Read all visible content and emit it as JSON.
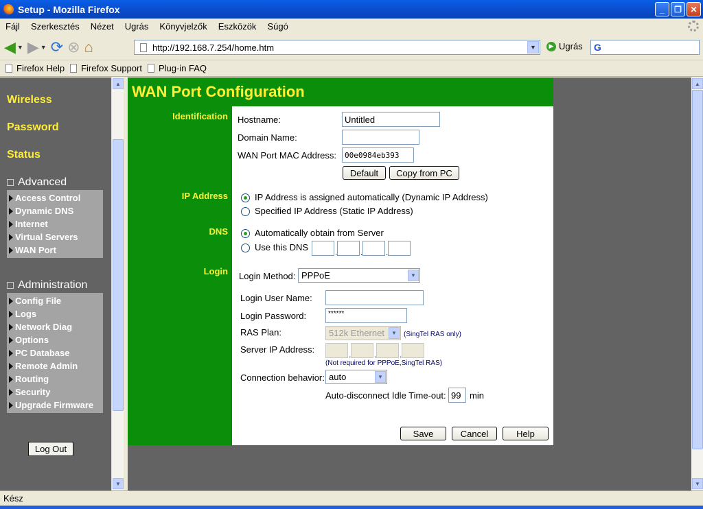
{
  "window": {
    "title": "Setup - Mozilla Firefox"
  },
  "menu": [
    "Fájl",
    "Szerkesztés",
    "Nézet",
    "Ugrás",
    "Könyvjelzők",
    "Eszközök",
    "Súgó"
  ],
  "toolbar": {
    "url": "http://192.168.7.254/home.htm",
    "go_label": "Ugrás"
  },
  "bookmarks": [
    "Firefox Help",
    "Firefox Support",
    "Plug-in FAQ"
  ],
  "sidebar": {
    "top_links": [
      "Wireless",
      "Password",
      "Status"
    ],
    "advanced": {
      "heading": "Advanced",
      "items": [
        "Access Control",
        "Dynamic DNS",
        "Internet",
        "Virtual Servers",
        "WAN Port"
      ]
    },
    "administration": {
      "heading": "Administration",
      "items": [
        "Config File",
        "Logs",
        "Network Diag",
        "Options",
        "PC Database",
        "Remote Admin",
        "Routing",
        "Security",
        "Upgrade Firmware"
      ]
    },
    "logout_label": "Log Out"
  },
  "main": {
    "title": "WAN Port Configuration",
    "identification": {
      "section_label": "Identification",
      "hostname_label": "Hostname:",
      "hostname_value": "Untitled",
      "domain_label": "Domain Name:",
      "domain_value": "",
      "mac_label": "WAN Port MAC Address:",
      "mac_value": "00e0984eb393",
      "default_button": "Default",
      "copy_button": "Copy from PC"
    },
    "ip_address": {
      "section_label": "IP Address",
      "option_dynamic": "IP Address is assigned automatically (Dynamic IP Address)",
      "option_static": "Specified IP Address (Static IP Address)",
      "selected": "dynamic"
    },
    "dns": {
      "section_label": "DNS",
      "option_auto": "Automatically obtain from Server",
      "option_manual": "Use this DNS",
      "selected": "auto"
    },
    "login": {
      "section_label": "Login",
      "method_label": "Login Method:",
      "method_value": "PPPoE",
      "username_label": "Login User Name:",
      "username_value": "",
      "password_label": "Login Password:",
      "password_value": "******",
      "ras_label": "RAS Plan:",
      "ras_value": "512k Ethernet",
      "ras_note": "(SingTel RAS only)",
      "server_ip_label": "Server IP Address:",
      "server_ip_note": "(Not required for PPPoE,SingTel RAS)",
      "connection_label": "Connection behavior:",
      "connection_value": "auto",
      "idle_label": "Auto-disconnect Idle Time-out:",
      "idle_value": "99",
      "idle_unit": "min"
    },
    "buttons": {
      "save": "Save",
      "cancel": "Cancel",
      "help": "Help"
    }
  },
  "status_bar": {
    "text": "Kész"
  }
}
